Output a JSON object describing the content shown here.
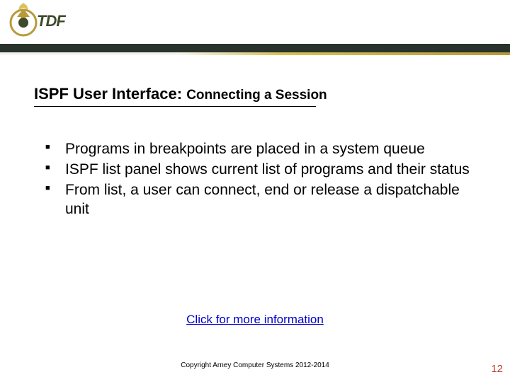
{
  "header": {
    "logo_text": "TDF",
    "logo_sub": ""
  },
  "title": {
    "main": "ISPF User Interface: ",
    "sub": "Connecting a Session"
  },
  "bullets": [
    "Programs in breakpoints are placed in a system queue",
    "ISPF list panel shows current list of programs and their status",
    "From list, a user can connect, end or release a dispatchable unit"
  ],
  "link": {
    "label": "Click for more information"
  },
  "footer": {
    "copyright": "Copyright Arney Computer Systems 2012-2014"
  },
  "page_number": "12"
}
